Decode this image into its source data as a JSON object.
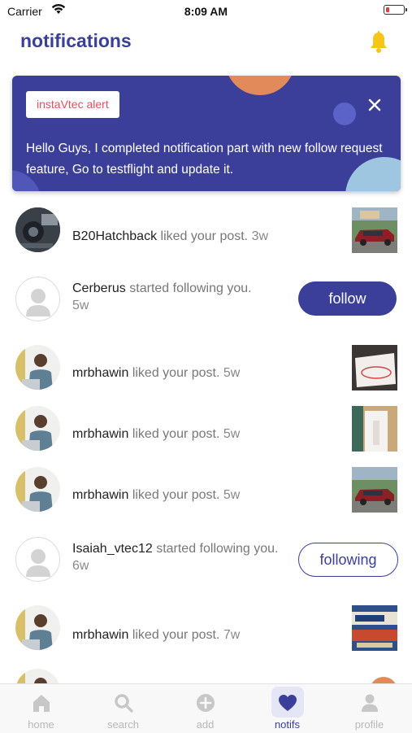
{
  "status_bar": {
    "carrier": "Carrier",
    "time": "8:09 AM"
  },
  "header": {
    "title": "notifications",
    "bell_icon": "bell-icon"
  },
  "alert": {
    "tag": "instaVtec alert",
    "message": "Hello Guys, I completed notification part with new follow request feature, Go to testflight and update it.",
    "close_icon": "close-icon"
  },
  "notifications": [
    {
      "user": "B20Hatchback",
      "action": "liked your post.",
      "time": "3w"
    },
    {
      "user": "Cerberus",
      "action": "started following you.",
      "time": "5w",
      "button": "follow"
    },
    {
      "user": "mrbhawin",
      "action": "liked your post.",
      "time": "5w"
    },
    {
      "user": "mrbhawin",
      "action": "liked your post.",
      "time": "5w"
    },
    {
      "user": "mrbhawin",
      "action": "liked your post.",
      "time": "5w"
    },
    {
      "user": "Isaiah_vtec12",
      "action": "started following you.",
      "time": "6w",
      "button": "following"
    },
    {
      "user": "mrbhawin",
      "action": "liked your post.",
      "time": "7w"
    }
  ],
  "tabs": [
    {
      "label": "home",
      "icon": "home-icon"
    },
    {
      "label": "search",
      "icon": "search-icon"
    },
    {
      "label": "add",
      "icon": "add-icon"
    },
    {
      "label": "notifs",
      "icon": "heart-icon",
      "active": true
    },
    {
      "label": "profile",
      "icon": "profile-icon"
    }
  ],
  "colors": {
    "primary": "#3c3f99",
    "accent_orange": "#e38a5a",
    "bell": "#f5c518",
    "alert_tag_text": "#e05060"
  }
}
